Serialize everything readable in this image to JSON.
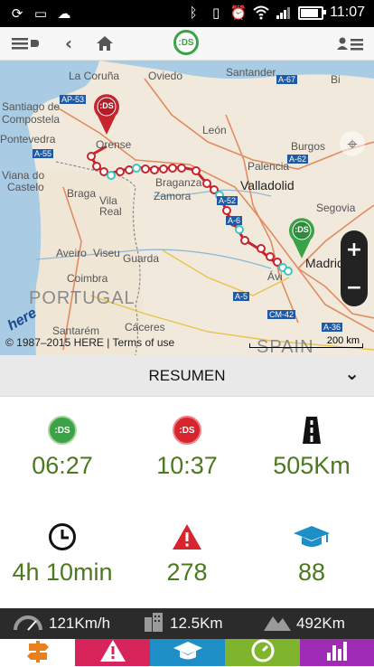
{
  "status_bar": {
    "time": "11:07",
    "left_icons": [
      "sync-icon",
      "image-icon",
      "cloud-icon"
    ],
    "right_icons": [
      "bluetooth-icon",
      "vibrate-icon",
      "alarm-icon",
      "wifi-icon",
      "signal-icon",
      "battery-icon"
    ]
  },
  "toolbar": {
    "menu_icon": "menu-icon",
    "back_icon": "back-arrow-icon",
    "home_icon": "home-icon",
    "logo_text": ":DS",
    "profile_icon": "user-list-icon"
  },
  "map": {
    "labels": {
      "la_coruna": "La Coruña",
      "oviedo": "Oviedo",
      "santander": "Santander",
      "bilbao": "Bi",
      "santiago": "Santiago de",
      "compostela": "Compostela",
      "pontevedra": "Pontevedra",
      "orense": "Orense",
      "leon": "León",
      "burgos": "Burgos",
      "viana": "Viana do",
      "castelo": "Castelo",
      "braga": "Braga",
      "braganza": "Braganza",
      "palencia": "Palencia",
      "valladolid": "Valladolid",
      "vila_real": "Vila",
      "vila_real2": "Real",
      "zamora": "Zamora",
      "aveiro": "Aveiro",
      "viseu": "Viseu",
      "guarda": "Guarda",
      "segovia": "Segovia",
      "avila": "Ávi",
      "madrid": "Madrid",
      "coimbra": "Coimbra",
      "portugal": "PORTUGAL",
      "spain": "SPAIN",
      "caceres": "Cáceres",
      "santarem": "Santarém",
      "road_a52": "A-52",
      "road_a6": "A-6",
      "road_a5": "A-5",
      "road_ap53": "AP-53",
      "road_a55": "A-55",
      "road_a67": "A-67",
      "road_a62": "A-62",
      "road_a36": "A-36",
      "road_cm42": "CM-42"
    },
    "start_marker_text": ":DS",
    "end_marker_text": ":DS",
    "copyright": "© 1987–2015 HERE | Terms of use",
    "here_logo": "here",
    "scale_text": "200 km",
    "zoom_in": "+",
    "zoom_out": "−"
  },
  "resumen": {
    "title": "RESUMEN"
  },
  "stats": {
    "start_time": {
      "icon": "start-ds-icon",
      "icon_text": ":DS",
      "value": "06:27"
    },
    "end_time": {
      "icon": "end-ds-icon",
      "icon_text": ":DS",
      "value": "10:37"
    },
    "distance": {
      "icon": "road-icon",
      "value": "505Km"
    },
    "duration": {
      "icon": "clock-icon",
      "value": "4h 10min"
    },
    "alerts": {
      "icon": "warning-icon",
      "value": "278"
    },
    "score": {
      "icon": "graduation-cap-icon",
      "value": "88"
    }
  },
  "info_bar": {
    "speed": "121Km/h",
    "urban": "12.5Km",
    "mountain": "492Km"
  },
  "tabs": [
    {
      "icon": "signpost-icon",
      "color": "#ffffff"
    },
    {
      "icon": "warning-icon",
      "color": "#d7245a"
    },
    {
      "icon": "graduation-cap-icon",
      "color": "#1e8fc6"
    },
    {
      "icon": "fuel-gauge-icon",
      "color": "#7fb52d"
    },
    {
      "icon": "bar-chart-icon",
      "color": "#9f2bb4"
    }
  ],
  "colors": {
    "stat_green": "#4b7a1e",
    "ds_green": "#3aa347",
    "ds_red": "#d7252f",
    "route_red": "#c8242d",
    "route_teal": "#3cc7c2"
  }
}
